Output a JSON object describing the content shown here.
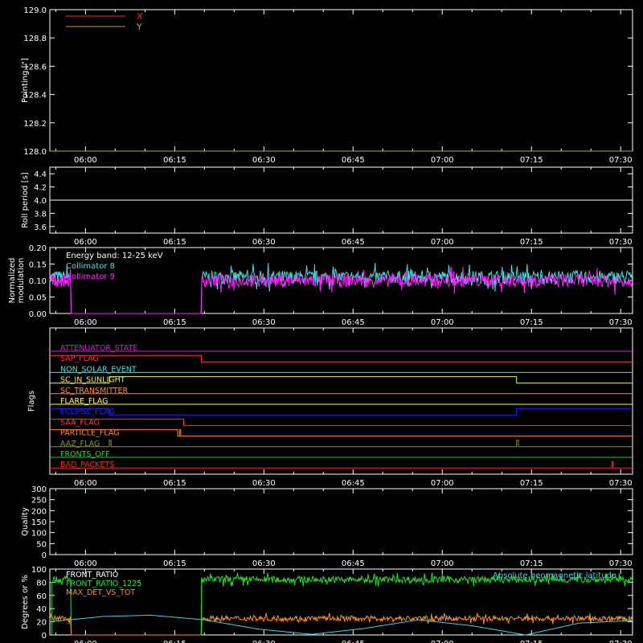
{
  "time_ticks": [
    "06:00",
    "06:15",
    "06:30",
    "06:45",
    "07:00",
    "07:15",
    "07:30"
  ],
  "time_range_min": [
    -6,
    92
  ],
  "tick_minutes": [
    0,
    15,
    30,
    45,
    60,
    75,
    90
  ],
  "chart_data": [
    {
      "type": "line",
      "ylabel": "Pointing [\"]",
      "ylim": [
        128.0,
        129.0
      ],
      "yticks": [
        "128.0",
        "128.2",
        "128.4",
        "128.6",
        "128.8",
        "129.0"
      ],
      "ytick_values": [
        128.0,
        128.2,
        128.4,
        128.6,
        128.8,
        129.0
      ],
      "legend": "top-left",
      "series": [
        {
          "name": "X",
          "color": "#ff2020",
          "x": [
            -6,
            92
          ],
          "y": [
            128.0,
            128.0
          ]
        },
        {
          "name": "Y",
          "color": "#b5a642",
          "x": [
            -6,
            92
          ],
          "y": [
            128.0,
            128.0
          ]
        }
      ]
    },
    {
      "type": "line",
      "ylabel": "Roll period [s]",
      "ylim": [
        3.5,
        4.5
      ],
      "yticks": [
        "3.6",
        "3.8",
        "4.0",
        "4.2",
        "4.4"
      ],
      "ytick_values": [
        3.6,
        3.8,
        4.0,
        4.2,
        4.4
      ],
      "series": [
        {
          "name": "",
          "color": "#ffffff",
          "x": [
            -6,
            92
          ],
          "y": [
            4.0,
            4.0
          ]
        }
      ]
    },
    {
      "type": "line",
      "ylabel": "Normalized modulation",
      "ylim": [
        0.0,
        0.2
      ],
      "yticks": [
        "0.00",
        "0.05",
        "0.10",
        "0.15",
        "0.20"
      ],
      "ytick_values": [
        0.0,
        0.05,
        0.1,
        0.15,
        0.2
      ],
      "annotation": "Energy band: 12-25 keV",
      "legend": "top-left",
      "series": [
        {
          "name": "Collimator 8",
          "color": "#40e0e0",
          "mean": 0.11,
          "noise": 0.02,
          "gap": [
            -2.5,
            19.5
          ]
        },
        {
          "name": "Collimator 9",
          "color": "#ff20ff",
          "mean": 0.1,
          "noise": 0.02,
          "gap": [
            -2.5,
            19.5
          ]
        }
      ]
    },
    {
      "type": "line",
      "ylabel": "Flags",
      "flags": [
        {
          "name": "ATTENUATOR_STATE",
          "color": "#d020d0",
          "segments": [
            [
              -6,
              0
            ],
            [
              92,
              0
            ]
          ]
        },
        {
          "name": "SAP_FLAG",
          "color": "#ff3030",
          "segments": [
            [
              -6,
              1
            ],
            [
              19.5,
              1
            ],
            [
              19.5,
              0
            ],
            [
              92,
              0
            ]
          ]
        },
        {
          "name": "NON_SOLAR_EVENT",
          "color": "#40e0e0",
          "segments": [
            [
              -6,
              0
            ],
            [
              92,
              0
            ]
          ]
        },
        {
          "name": "SC_IN_SUNLIGHT",
          "color": "#e8e870",
          "segments": [
            [
              -6,
              0
            ],
            [
              4,
              0
            ],
            [
              4,
              1
            ],
            [
              72.5,
              1
            ],
            [
              72.5,
              0
            ],
            [
              92,
              0
            ]
          ]
        },
        {
          "name": "SC_TRANSMITTER",
          "color": "#ff8c20",
          "segments": [
            [
              -6,
              0
            ],
            [
              92,
              0
            ]
          ]
        },
        {
          "name": "FLARE_FLAG",
          "color": "#ffff40",
          "segments": [
            [
              -6,
              0
            ],
            [
              92,
              0
            ]
          ]
        },
        {
          "name": "ECLIPSE_FLAG",
          "color": "#2020ff",
          "segments": [
            [
              -6,
              1
            ],
            [
              4,
              1
            ],
            [
              4,
              0
            ],
            [
              72.5,
              0
            ],
            [
              72.5,
              1
            ],
            [
              92,
              1
            ]
          ]
        },
        {
          "name": "SAA_FLAG",
          "color": "#ff3030",
          "segments": [
            [
              -6,
              1
            ],
            [
              16.5,
              1
            ],
            [
              16.5,
              0
            ],
            [
              92,
              0
            ]
          ]
        },
        {
          "name": "PARTICLE_FLAG",
          "color": "#ff8c20",
          "segments": [
            [
              -6,
              1
            ],
            [
              15.5,
              1
            ],
            [
              15.5,
              0
            ],
            [
              15.8,
              0
            ],
            [
              15.8,
              1
            ],
            [
              16.0,
              1
            ],
            [
              16.0,
              0
            ],
            [
              92,
              0
            ]
          ]
        },
        {
          "name": "AAZ_FLAG",
          "color": "#909030",
          "segments": [
            [
              -6,
              0
            ],
            [
              4,
              0
            ],
            [
              4,
              1
            ],
            [
              4.3,
              1
            ],
            [
              4.3,
              0
            ],
            [
              72.5,
              0
            ],
            [
              72.5,
              1
            ],
            [
              72.8,
              1
            ],
            [
              72.8,
              0
            ],
            [
              92,
              0
            ]
          ]
        },
        {
          "name": "FRONTS_OFF",
          "color": "#20d020",
          "segments": [
            [
              -6,
              0
            ],
            [
              92,
              0
            ]
          ]
        },
        {
          "name": "BAD_PACKETS",
          "color": "#ff2020",
          "segments": [
            [
              -6,
              0
            ],
            [
              88.5,
              0
            ],
            [
              88.5,
              1
            ],
            [
              88.7,
              1
            ],
            [
              88.7,
              0
            ],
            [
              92,
              0
            ]
          ]
        }
      ]
    },
    {
      "type": "line",
      "ylabel": "Quality",
      "ylim": [
        0,
        300
      ],
      "yticks": [
        "0",
        "50",
        "100",
        "150",
        "200",
        "250",
        "300"
      ],
      "ytick_values": [
        0,
        50,
        100,
        150,
        200,
        250,
        300
      ],
      "series": []
    },
    {
      "type": "line",
      "ylabel": "Degrees or %",
      "ylim": [
        0,
        100
      ],
      "yticks": [
        "0",
        "20",
        "40",
        "60",
        "80",
        "100"
      ],
      "ytick_values": [
        0,
        20,
        40,
        60,
        80,
        100
      ],
      "legend": "top-left",
      "annotation_right": "Absolute geomagnetic latitude",
      "series": [
        {
          "name": "FRONT_RATIO",
          "color": "#ffffff",
          "x": [],
          "y": []
        },
        {
          "name": "FRONT_RATIO_1225",
          "color": "#20e020",
          "mean": 84,
          "noise": 5,
          "gap": [
            -2.5,
            19.5
          ],
          "lead": [
            -6,
            -5.5
          ]
        },
        {
          "name": "MAX_DET_VS_TOT",
          "color": "#ff9020",
          "mean": 25,
          "noise": 4,
          "gap": [
            -2.5,
            19.5
          ]
        },
        {
          "name": "Absolute geomagnetic latitude",
          "color": "#40d0e0",
          "x": [
            -6,
            3,
            11,
            20,
            29,
            38,
            47,
            56,
            65,
            74,
            83,
            92
          ],
          "y": [
            20,
            28,
            30,
            23,
            9,
            1,
            10,
            23,
            14,
            0,
            18,
            22
          ]
        }
      ]
    }
  ]
}
